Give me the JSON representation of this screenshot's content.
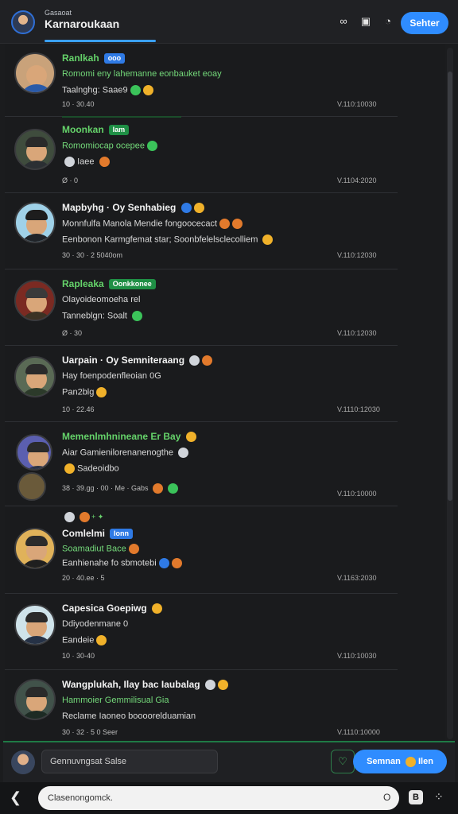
{
  "header": {
    "subtitle": "Gasaoat",
    "title": "Karnaroukaan",
    "icons": [
      "link-icon",
      "square-icon",
      "clock-icon"
    ],
    "button_label": "Sehter"
  },
  "posts": [
    {
      "name": "Ranlkah",
      "badge": "ooo",
      "line1": "Romomi eny lahemanne eonbauket eoay",
      "line2": "Taalnghg: Saae9",
      "time": "V.110:10030",
      "meta": "10 · 30.40"
    },
    {
      "name": "Moonkan",
      "badge": "Iam",
      "line1": "Romomiocap ocepee",
      "line2": "Iaee",
      "time": "V.1104:2020",
      "meta": "Ø · 0"
    },
    {
      "name": "Mapbyhg · Oy Senhabieg",
      "badge": "",
      "line1": "Monnfulfa Manola Mendie fongoocecact",
      "line2": "Eenbonon Karmgfemat star; Soonbfelelsclecolliem",
      "time": "V.110:12030",
      "meta": "30 · 30 · 2 5040om"
    },
    {
      "name": "Rapleaka",
      "badge": "Oonkkonee",
      "line1": "Olayoideomoeha rel",
      "line2": "Tanneblgn: Soalt",
      "time": "V.110:12030",
      "meta": "Ø · 30"
    },
    {
      "name": "Uarpain · Oy Semniteraang",
      "badge": "",
      "line1": "Hay foenpodenfleoian 0G",
      "line2": "Pan2blg",
      "time": "V.1110:12030",
      "meta": "10 · 22.46"
    },
    {
      "name": "Memenlmhnineane Er Bay",
      "badge": "",
      "line1": "Aiar Gamienilorenanenogthe",
      "line2": "Sadeoidbo",
      "time": "V.110:10000",
      "meta": "38 · 39.gg · 00 · Me · Gabs"
    },
    {
      "name": "Comlelmi",
      "badge": "Ionn",
      "line1": "Soamadiut Bace",
      "line2": "Eanhienahe fo sbmotebi",
      "time": "V.1163:2030",
      "meta": "20 · 40.ee · 5"
    },
    {
      "name": "Capesica Goepiwg",
      "badge": "",
      "line1": "Ddiyodenmane 0",
      "line2": "Eandeie",
      "time": "V.110:10030",
      "meta": "10 · 30-40"
    },
    {
      "name": "Wangplukah, Ilay bac Iaubalag",
      "badge": "",
      "line1": "Hammoier Gemmilisual Gia",
      "line2": "Reclame Iaoneo boooorelduamian",
      "time": "V.1110:10000",
      "meta": "30 · 32 · 5 0 Seer"
    }
  ],
  "compose": {
    "text": "Gennuvngsat Salse",
    "send_label": "Semnan",
    "send_suffix": "Ilen"
  },
  "bottombar": {
    "input_placeholder": "Clasenongomck.",
    "input_suffix": "O"
  },
  "colors": {
    "accent": "#2f8cff",
    "name_green": "#65d36a",
    "background": "#1b1c1e"
  }
}
